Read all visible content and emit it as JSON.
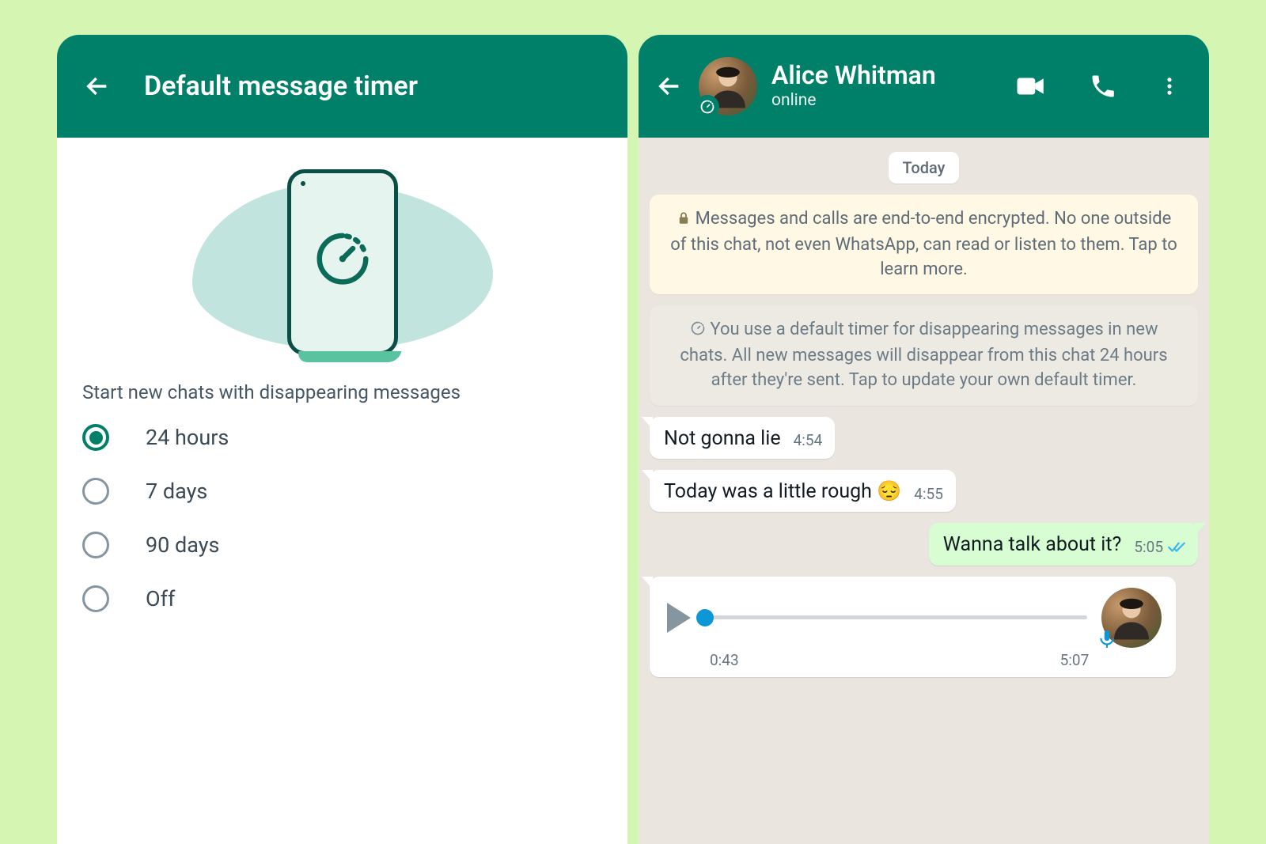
{
  "colors": {
    "teal": "#008069",
    "accent": "#25d366"
  },
  "left": {
    "title": "Default message timer",
    "section_label": "Start new chats with disappearing messages",
    "options": [
      "24 hours",
      "7 days",
      "90 days",
      "Off"
    ],
    "selected_index": 0
  },
  "right": {
    "contact_name": "Alice Whitman",
    "contact_status": "online",
    "date_pill": "Today",
    "encryption": "Messages and calls are end-to-end encrypted. No one outside of this chat, not even WhatsApp, can read or listen to them. Tap to learn more.",
    "timer_notice": "You use a default timer for disappearing messages in new chats. All new messages will disappear from this chat 24 hours after they're sent. Tap to update your own default timer.",
    "messages": [
      {
        "dir": "in",
        "text": "Not gonna lie",
        "time": "4:54"
      },
      {
        "dir": "in",
        "text": "Today was a little rough 😔",
        "time": "4:55"
      },
      {
        "dir": "out",
        "text": "Wanna talk about it?",
        "time": "5:05",
        "read": true
      }
    ],
    "voice": {
      "elapsed": "0:43",
      "total": "5:07"
    }
  }
}
